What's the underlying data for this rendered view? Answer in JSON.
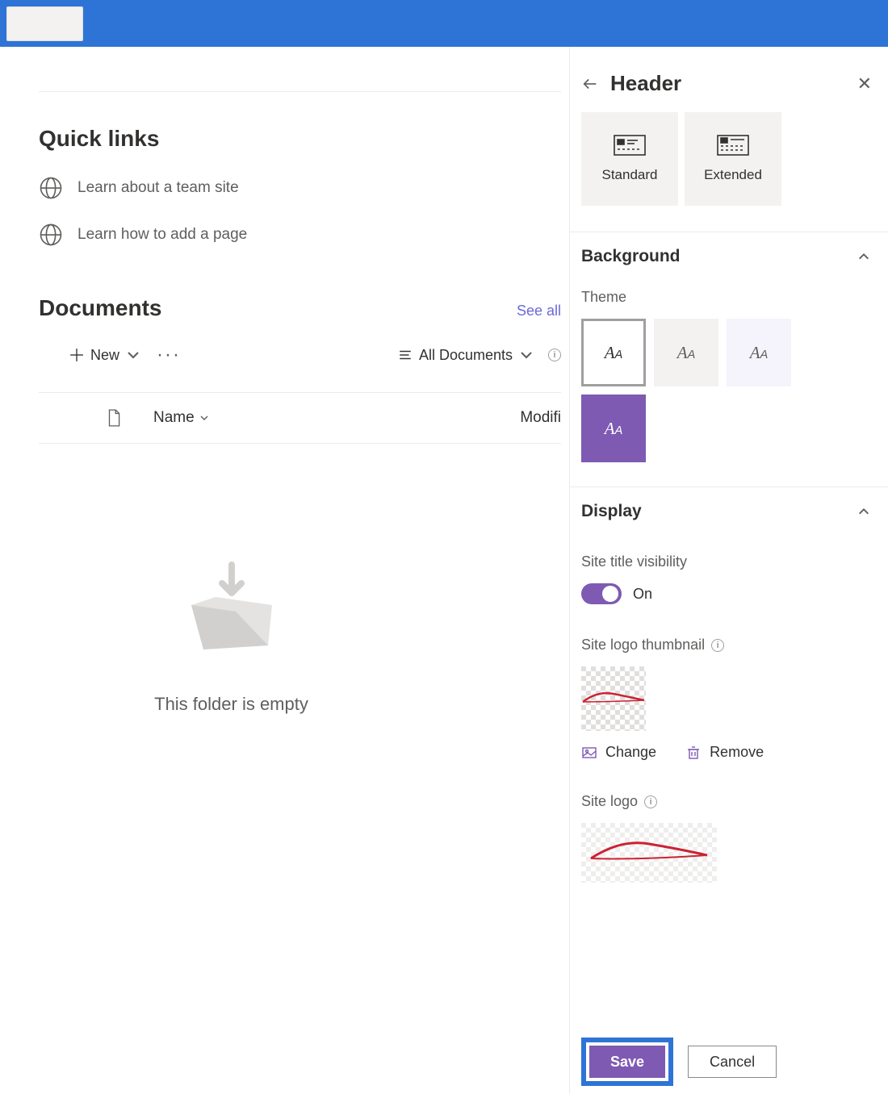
{
  "quicklinks": {
    "title": "Quick links",
    "items": [
      {
        "label": "Learn about a team site"
      },
      {
        "label": "Learn how to add a page"
      }
    ]
  },
  "documents": {
    "title": "Documents",
    "see_all": "See all",
    "new_label": "New",
    "view_label": "All Documents",
    "columns": {
      "name": "Name",
      "modified": "Modifi"
    },
    "empty_text": "This folder is empty"
  },
  "panel": {
    "title": "Header",
    "layouts": {
      "standard": "Standard",
      "extended": "Extended"
    },
    "background": {
      "title": "Background",
      "theme_label": "Theme"
    },
    "display": {
      "title": "Display",
      "site_title_visibility": "Site title visibility",
      "toggle_label": "On",
      "site_logo_thumbnail": "Site logo thumbnail",
      "change": "Change",
      "remove": "Remove",
      "site_logo": "Site logo"
    },
    "footer": {
      "save": "Save",
      "cancel": "Cancel"
    }
  }
}
